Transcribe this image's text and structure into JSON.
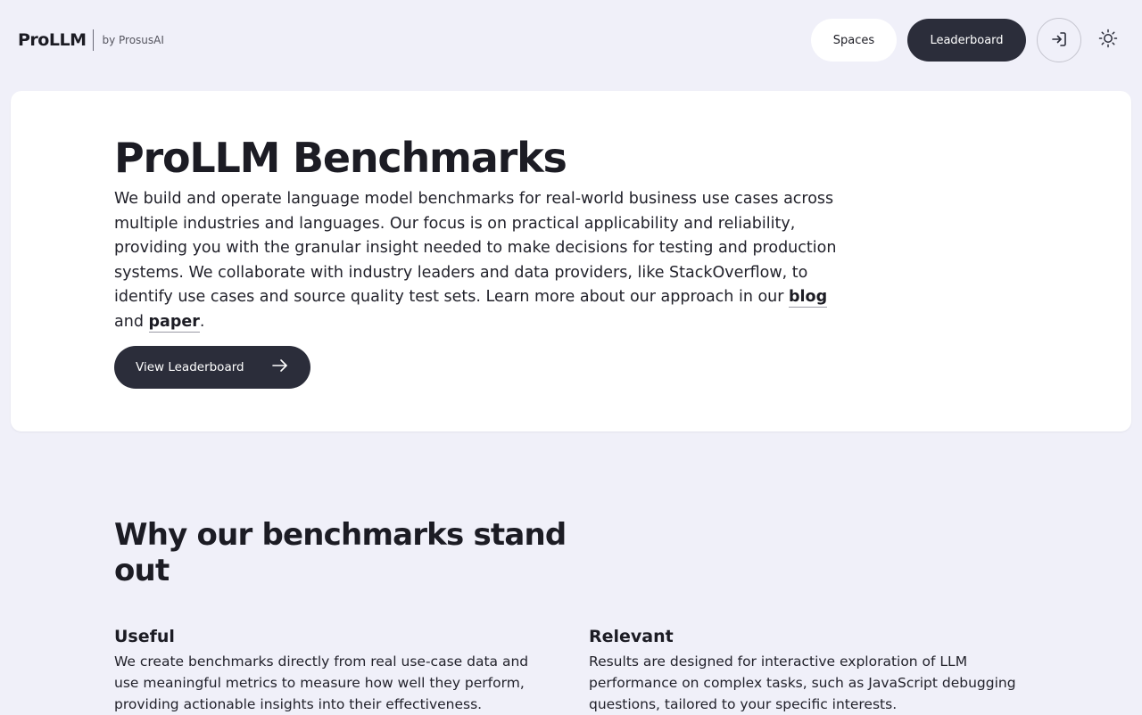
{
  "header": {
    "brand_name": "ProLLM",
    "brand_by": "by ProsusAI",
    "nav": {
      "spaces_label": "Spaces",
      "leaderboard_label": "Leaderboard",
      "login_icon": "login-icon",
      "theme_icon": "sun-icon"
    }
  },
  "hero": {
    "title": "ProLLM Benchmarks",
    "description_before": "We build and operate language model benchmarks for real-world business use cases across multiple industries and languages. Our focus is on practical applicability and reliability, providing you with the granular insight needed to make decisions for testing and production systems. We collaborate with industry leaders and data providers, like StackOverflow, to identify use cases and source quality test sets. Learn more about our approach in our ",
    "blog_link": "blog",
    "and_text": " and ",
    "paper_link": "paper",
    "period": ".",
    "cta_label": "View Leaderboard",
    "cta_icon": "arrow-right-icon"
  },
  "why": {
    "title": "Why our benchmarks stand out",
    "features": [
      {
        "title": "Useful",
        "text": "We create benchmarks directly from real use-case data and use meaningful metrics to measure how well they perform, providing actionable insights into their effectiveness."
      },
      {
        "title": "Relevant",
        "text": "Results are designed for interactive exploration of LLM performance on complex tasks, such as JavaScript debugging questions, tailored to your specific interests."
      }
    ]
  },
  "colors": {
    "background": "#f0f0f9",
    "card": "#ffffff",
    "primary_dark": "#2b2d3a",
    "text": "#1c1c24"
  }
}
